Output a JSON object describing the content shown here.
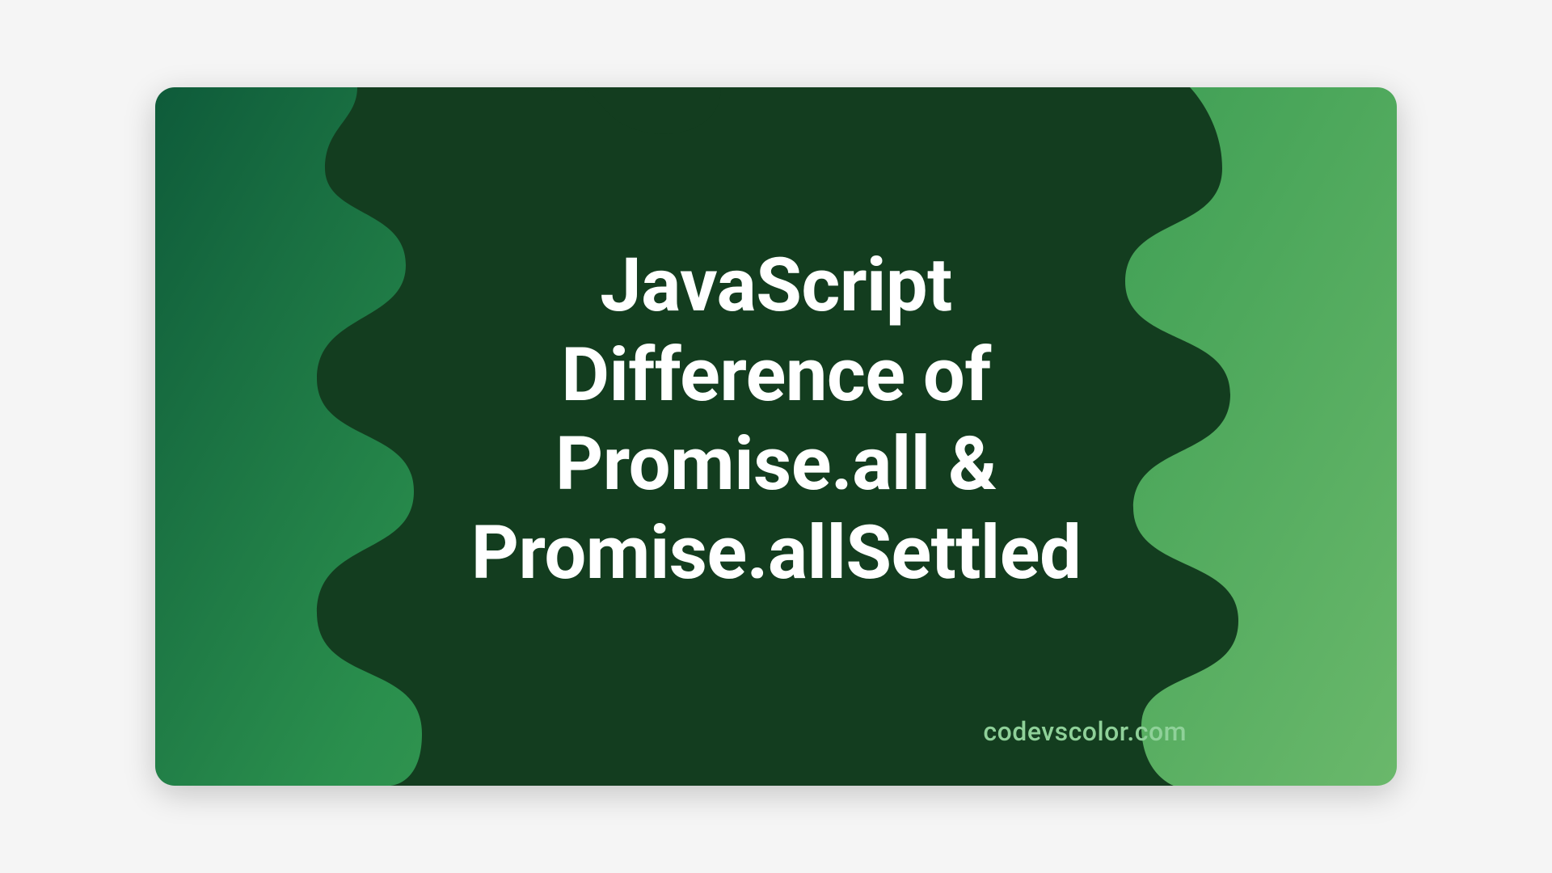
{
  "title_line1": "JavaScript",
  "title_line2": "Difference of",
  "title_line3": "Promise.all &",
  "title_line4": "Promise.allSettled",
  "watermark": "codevscolor.com",
  "colors": {
    "dark_blob": "#133d1f",
    "text": "#ffffff",
    "watermark": "#8fd199"
  }
}
